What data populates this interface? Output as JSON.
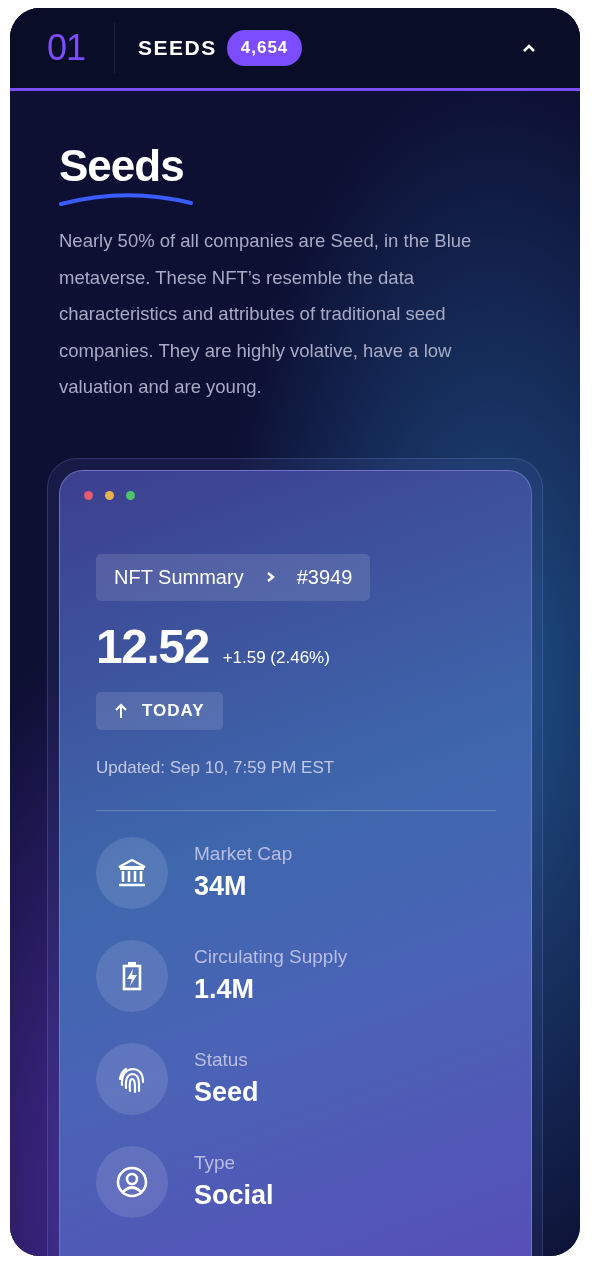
{
  "section": {
    "number": "01",
    "name": "SEEDS",
    "count": "4,654",
    "expanded": true
  },
  "title": "Seeds",
  "description": "Nearly 50% of all companies are Seed, in the Blue metaverse. These NFT’s resemble the data characteristics and attributes of traditional seed companies. They are highly volative, have a low valuation and are young.",
  "card": {
    "breadcrumb": [
      "NFT Summary",
      "#3949"
    ],
    "price": "12.52",
    "change": "+1.59 (2.46%)",
    "period": "TODAY",
    "updated": "Updated: Sep 10, 7:59 PM EST",
    "stats": [
      {
        "kind": "bank",
        "label": "Market Cap",
        "value": "34M"
      },
      {
        "kind": "battery",
        "label": "Circulating Supply",
        "value": "1.4M"
      },
      {
        "kind": "fingerprint",
        "label": "Status",
        "value": "Seed"
      },
      {
        "kind": "user",
        "label": "Type",
        "value": "Social"
      }
    ]
  }
}
